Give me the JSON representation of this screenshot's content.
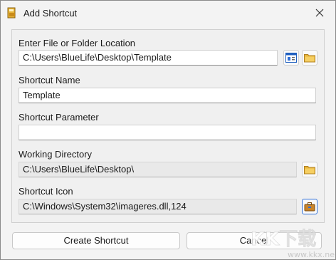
{
  "window": {
    "title": "Add Shortcut",
    "close_icon": "close-icon",
    "app_icon": "shortcut-app-icon"
  },
  "form": {
    "location_label": "Enter File or Folder Location",
    "location_value": "C:\\Users\\BlueLife\\Desktop\\Template",
    "name_label": "Shortcut Name",
    "name_value": "Template",
    "param_label": "Shortcut Parameter",
    "param_value": "",
    "workdir_label": "Working Directory",
    "workdir_value": "C:\\Users\\BlueLife\\Desktop\\",
    "icon_label": "Shortcut Icon",
    "icon_value": "C:\\Windows\\System32\\imageres.dll,124"
  },
  "buttons": {
    "create": "Create Shortcut",
    "cancel": "Cancel"
  },
  "watermark": {
    "text": "KK下载",
    "url": "www.kkx.net"
  },
  "colors": {
    "folder": "#e8b53a",
    "accent": "#2f6fd6"
  }
}
